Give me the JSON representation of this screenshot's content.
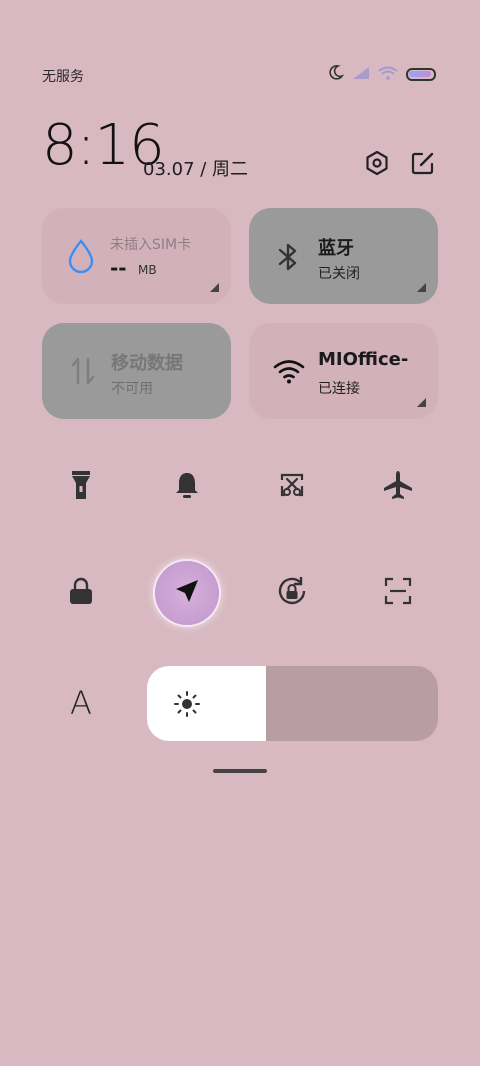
{
  "status_bar": {
    "carrier": "无服务",
    "icons": [
      "moon-icon",
      "signal-icon",
      "wifi-icon",
      "battery-icon"
    ]
  },
  "header": {
    "time": "8:16",
    "date": "03.07 / 周二",
    "actions": [
      "settings-icon",
      "edit-icon"
    ]
  },
  "tiles": {
    "data_usage": {
      "title": "未插入SIM卡",
      "value": "--",
      "unit": "MB",
      "icon": "water-drop-icon"
    },
    "bluetooth": {
      "title": "蓝牙",
      "status": "已关闭",
      "icon": "bluetooth-icon"
    },
    "mobile_data": {
      "title": "移动数据",
      "status": "不可用",
      "icon": "data-arrows-icon"
    },
    "wifi": {
      "title": "MIOffice-",
      "status": "已连接",
      "icon": "wifi-icon"
    }
  },
  "toggles": [
    {
      "name": "flashlight",
      "icon": "flashlight-icon"
    },
    {
      "name": "notifications",
      "icon": "bell-icon"
    },
    {
      "name": "screenshot",
      "icon": "scissors-icon"
    },
    {
      "name": "airplane-mode",
      "icon": "airplane-icon"
    },
    {
      "name": "lock-screen",
      "icon": "lock-icon"
    },
    {
      "name": "location",
      "icon": "location-arrow-icon",
      "active": true
    },
    {
      "name": "auto-rotate",
      "icon": "rotation-lock-icon"
    },
    {
      "name": "scanner",
      "icon": "scan-icon"
    }
  ],
  "brightness": {
    "font_icon_label": "A",
    "level": 0.41,
    "icon": "sun-icon"
  },
  "colors": {
    "background": "#d8b9c2",
    "tile_on": "#d2b1ba",
    "tile_off": "#9a9a9a",
    "accent_blue": "#3b8ff0"
  }
}
